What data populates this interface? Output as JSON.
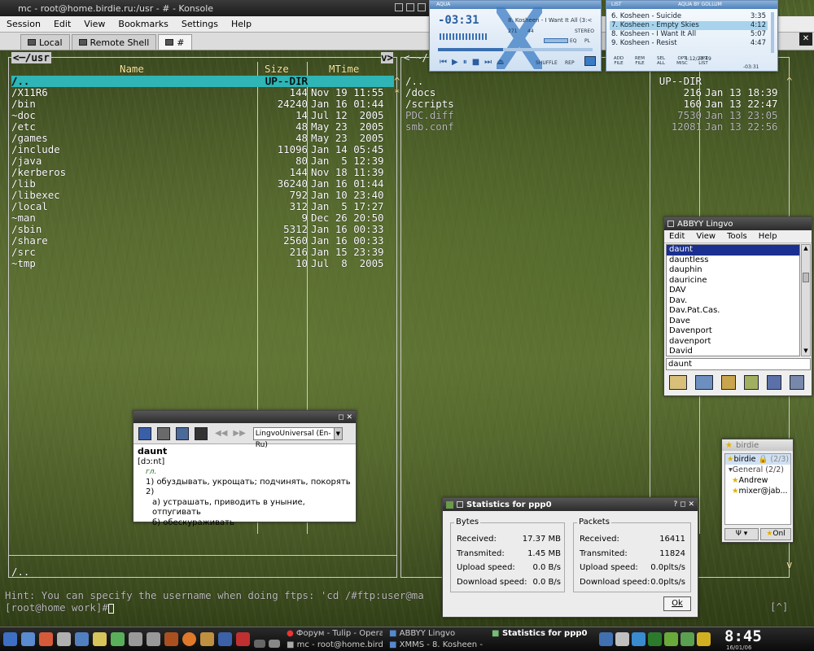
{
  "konsole": {
    "title": "mc - root@home.birdie.ru:/usr - # - Konsole",
    "menu": [
      "Session",
      "Edit",
      "View",
      "Bookmarks",
      "Settings",
      "Help"
    ],
    "tabs": [
      "Local",
      "Remote Shell",
      "#"
    ]
  },
  "mc": {
    "left_path": "/usr",
    "left_header": {
      "name": "Name",
      "size": "Size",
      "mtime": "MTime"
    },
    "left_rows": [
      [
        "/..",
        "UP--DIR",
        ""
      ],
      [
        "/X11R6",
        "144",
        "Nov 19 11:55"
      ],
      [
        "/bin",
        "24240",
        "Jan 16 01:44"
      ],
      [
        "~doc",
        "14",
        "Jul 12  2005"
      ],
      [
        "/etc",
        "48",
        "May 23  2005"
      ],
      [
        "/games",
        "48",
        "May 23  2005"
      ],
      [
        "/include",
        "11096",
        "Jan 14 05:45"
      ],
      [
        "/java",
        "80",
        "Jan  5 12:39"
      ],
      [
        "/kerberos",
        "144",
        "Nov 18 11:39"
      ],
      [
        "/lib",
        "36240",
        "Jan 16 01:44"
      ],
      [
        "/libexec",
        "792",
        "Jan 10 23:40"
      ],
      [
        "/local",
        "312",
        "Jan  5 17:27"
      ],
      [
        "~man",
        "9",
        "Dec 26 20:50"
      ],
      [
        "/sbin",
        "5312",
        "Jan 16 00:33"
      ],
      [
        "/share",
        "2560",
        "Jan 16 00:33"
      ],
      [
        "/src",
        "216",
        "Jan 15 23:39"
      ],
      [
        "~tmp",
        "10",
        "Jul  8  2005"
      ]
    ],
    "right_rows": [
      [
        "/..",
        "UP--DIR",
        ""
      ],
      [
        "/docs",
        "216",
        "Jan 13 18:39"
      ],
      [
        "/scripts",
        "160",
        "Jan 13 22:47"
      ],
      [
        "PDC.diff",
        "7530",
        "Jan 13 23:05"
      ],
      [
        "smb.conf",
        "12081",
        "Jan 13 22:56"
      ]
    ],
    "left_footer": "/..",
    "hint": "Hint: You can specify the username when doing ftps: 'cd /#ftp:user@ma",
    "prompt": "[root@home work]#",
    "corner": "[^]"
  },
  "xmms": {
    "title": "AQUA",
    "time": "-03:31",
    "track": "8. Kosheen - I Want It All (3:<",
    "kbps": "271",
    "khz": "44",
    "stereo": "STEREO",
    "eq": "EQ",
    "pl": "PL",
    "shuffle": "SHUFFLE",
    "rep": "REP"
  },
  "playlist": {
    "title_left": "LIST",
    "title_right": "AQUA BY GOLLUM",
    "items": [
      {
        "n": "6. Kosheen - Suicide",
        "t": "3:35"
      },
      {
        "n": "7. Kosheen - Empty Skies",
        "t": "4:12"
      },
      {
        "n": "8. Kosheen - I Want It All",
        "t": "5:07"
      },
      {
        "n": "9. Kosheen - Resist",
        "t": "4:47"
      }
    ],
    "buttons": [
      "FILE",
      "FILE",
      "ALL",
      "MISC",
      "LIST"
    ],
    "buttons2": [
      "ADD",
      "REM",
      "SEL",
      "OPT",
      "OPT"
    ],
    "total": "4:12/20:49",
    "elapsed": "-03:31"
  },
  "lingvo": {
    "title": "ABBYY Lingvo",
    "menu": [
      "Edit",
      "View",
      "Tools",
      "Help"
    ],
    "words": [
      "daunt",
      "dauntless",
      "dauphin",
      "dauricine",
      "DAV",
      "Dav.",
      "Dav.Pat.Cas.",
      "Dave",
      "Davenport",
      "davenport",
      "David"
    ],
    "input": "daunt"
  },
  "popup": {
    "dictionary": "LingvoUniversal (En-Ru)",
    "word": "daunt",
    "transcription": "[dɔːnt]",
    "pos": "гл.",
    "lines": [
      "1) обуздывать, укрощать; подчинять, покорять",
      "2)",
      "а) устрашать, приводить в уныние, отпугивать",
      "б) обескураживать"
    ]
  },
  "stats": {
    "title": "Statistics for ppp0",
    "bytes_title": "Bytes",
    "packets_title": "Packets",
    "bytes": [
      [
        "Received:",
        "17.37 MB"
      ],
      [
        "Transmited:",
        "1.45 MB"
      ],
      [
        "Upload speed:",
        "0.0 B/s"
      ],
      [
        "Download speed:",
        "0.0 B/s"
      ]
    ],
    "packets": [
      [
        "Received:",
        "16411"
      ],
      [
        "Transmited:",
        "11824"
      ],
      [
        "Upload speed:",
        "0.0plts/s"
      ],
      [
        "Download speed:",
        "0.0plts/s"
      ]
    ],
    "ok": "Ok"
  },
  "im": {
    "title": "birdie",
    "account": "birdie",
    "account_count": "(2/3)",
    "group": "General",
    "group_count": "(2/2)",
    "contacts": [
      "Andrew",
      "mixer@jab..."
    ],
    "status": "Onl"
  },
  "taskbar": {
    "tasks": [
      "Форум - Tulip - Opera",
      "ABBYY Lingvo",
      "Statistics for ppp0",
      "mc - root@home.birdie.ru",
      "XMMS - 8. Kosheen - I"
    ],
    "clock": "8:45",
    "date": "16/01/06"
  },
  "colors": {
    "selection": "#2fb5b5",
    "mc_header": "#ffec9f",
    "lingvo_sel": "#1a2f8f",
    "playlist_sel": "#a7d4ec"
  }
}
